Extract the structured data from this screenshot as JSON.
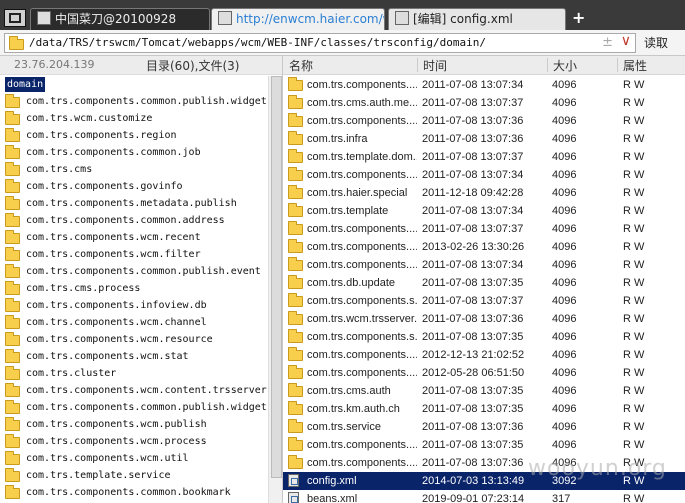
{
  "tabs": [
    {
      "label": "中国菜刀@20100928",
      "icon": "window-icon"
    },
    {
      "label": "http://enwcm.haier.com/web...",
      "icon": "page-icon"
    },
    {
      "label": "[编辑] config.xml",
      "icon": "edit-icon"
    }
  ],
  "new_tab": "+",
  "address": {
    "path": "/data/TRS/trswcm/Tomcat/webapps/wcm/WEB-INF/classes/trsconfig/domain/",
    "plus": "±",
    "dropdown": "∨",
    "read_button": "读取"
  },
  "left_pane": {
    "ip": "23.76.204.139",
    "count": "目录(60),文件(3)",
    "root": "domain",
    "items": [
      "com.trs.components.common.publish.widget",
      "com.trs.wcm.customize",
      "com.trs.components.region",
      "com.trs.components.common.job",
      "com.trs.cms",
      "com.trs.components.govinfo",
      "com.trs.components.metadata.publish",
      "com.trs.components.common.address",
      "com.trs.components.wcm.recent",
      "com.trs.components.wcm.filter",
      "com.trs.components.common.publish.event",
      "com.trs.cms.process",
      "com.trs.components.infoview.db",
      "com.trs.components.wcm.channel",
      "com.trs.components.wcm.resource",
      "com.trs.components.wcm.stat",
      "com.trs.cluster",
      "com.trs.components.wcm.content.trsserver",
      "com.trs.components.common.publish.widget.",
      "com.trs.components.wcm.publish",
      "com.trs.components.wcm.process",
      "com.trs.components.wcm.util",
      "com.trs.template.service",
      "com.trs.components.common.bookmark"
    ]
  },
  "columns": {
    "name": "名称",
    "time": "时间",
    "size": "大小",
    "attr": "属性"
  },
  "files": [
    {
      "name": "com.trs.components....",
      "time": "2011-07-08 13:07:34",
      "size": "4096",
      "attr": "R W",
      "icon": "folder-icon"
    },
    {
      "name": "com.trs.cms.auth.me...",
      "time": "2011-07-08 13:07:37",
      "size": "4096",
      "attr": "R W",
      "icon": "folder-icon"
    },
    {
      "name": "com.trs.components....",
      "time": "2011-07-08 13:07:36",
      "size": "4096",
      "attr": "R W",
      "icon": "folder-icon"
    },
    {
      "name": "com.trs.infra",
      "time": "2011-07-08 13:07:36",
      "size": "4096",
      "attr": "R W",
      "icon": "folder-icon"
    },
    {
      "name": "com.trs.template.dom...",
      "time": "2011-07-08 13:07:37",
      "size": "4096",
      "attr": "R W",
      "icon": "folder-icon"
    },
    {
      "name": "com.trs.components....",
      "time": "2011-07-08 13:07:34",
      "size": "4096",
      "attr": "R W",
      "icon": "folder-icon"
    },
    {
      "name": "com.trs.haier.special",
      "time": "2011-12-18 09:42:28",
      "size": "4096",
      "attr": "R W",
      "icon": "folder-icon"
    },
    {
      "name": "com.trs.template",
      "time": "2011-07-08 13:07:34",
      "size": "4096",
      "attr": "R W",
      "icon": "folder-icon"
    },
    {
      "name": "com.trs.components....",
      "time": "2011-07-08 13:07:37",
      "size": "4096",
      "attr": "R W",
      "icon": "folder-icon"
    },
    {
      "name": "com.trs.components....",
      "time": "2013-02-26 13:30:26",
      "size": "4096",
      "attr": "R W",
      "icon": "folder-icon"
    },
    {
      "name": "com.trs.components....",
      "time": "2011-07-08 13:07:34",
      "size": "4096",
      "attr": "R W",
      "icon": "folder-icon"
    },
    {
      "name": "com.trs.db.update",
      "time": "2011-07-08 13:07:35",
      "size": "4096",
      "attr": "R W",
      "icon": "folder-icon"
    },
    {
      "name": "com.trs.components.s...",
      "time": "2011-07-08 13:07:37",
      "size": "4096",
      "attr": "R W",
      "icon": "folder-icon"
    },
    {
      "name": "com.trs.wcm.trsserver...",
      "time": "2011-07-08 13:07:36",
      "size": "4096",
      "attr": "R W",
      "icon": "folder-icon"
    },
    {
      "name": "com.trs.components.s...",
      "time": "2011-07-08 13:07:35",
      "size": "4096",
      "attr": "R W",
      "icon": "folder-icon"
    },
    {
      "name": "com.trs.components....",
      "time": "2012-12-13 21:02:52",
      "size": "4096",
      "attr": "R W",
      "icon": "folder-icon"
    },
    {
      "name": "com.trs.components....",
      "time": "2012-05-28 06:51:50",
      "size": "4096",
      "attr": "R W",
      "icon": "folder-icon"
    },
    {
      "name": "com.trs.cms.auth",
      "time": "2011-07-08 13:07:35",
      "size": "4096",
      "attr": "R W",
      "icon": "folder-icon"
    },
    {
      "name": "com.trs.km.auth.ch",
      "time": "2011-07-08 13:07:35",
      "size": "4096",
      "attr": "R W",
      "icon": "folder-icon"
    },
    {
      "name": "com.trs.service",
      "time": "2011-07-08 13:07:36",
      "size": "4096",
      "attr": "R W",
      "icon": "folder-icon"
    },
    {
      "name": "com.trs.components....",
      "time": "2011-07-08 13:07:35",
      "size": "4096",
      "attr": "R W",
      "icon": "folder-icon"
    },
    {
      "name": "com.trs.components....",
      "time": "2011-07-08 13:07:36",
      "size": "4096",
      "attr": "R W",
      "icon": "folder-icon"
    },
    {
      "name": "config.xml",
      "time": "2014-07-03 13:13:49",
      "size": "3092",
      "attr": "R W",
      "icon": "xml-file-icon",
      "selected": true
    },
    {
      "name": "beans.xml",
      "time": "2019-09-01 07:23:14",
      "size": "317",
      "attr": "R W",
      "icon": "xml-file-icon"
    }
  ],
  "watermark": "wooyun.org"
}
